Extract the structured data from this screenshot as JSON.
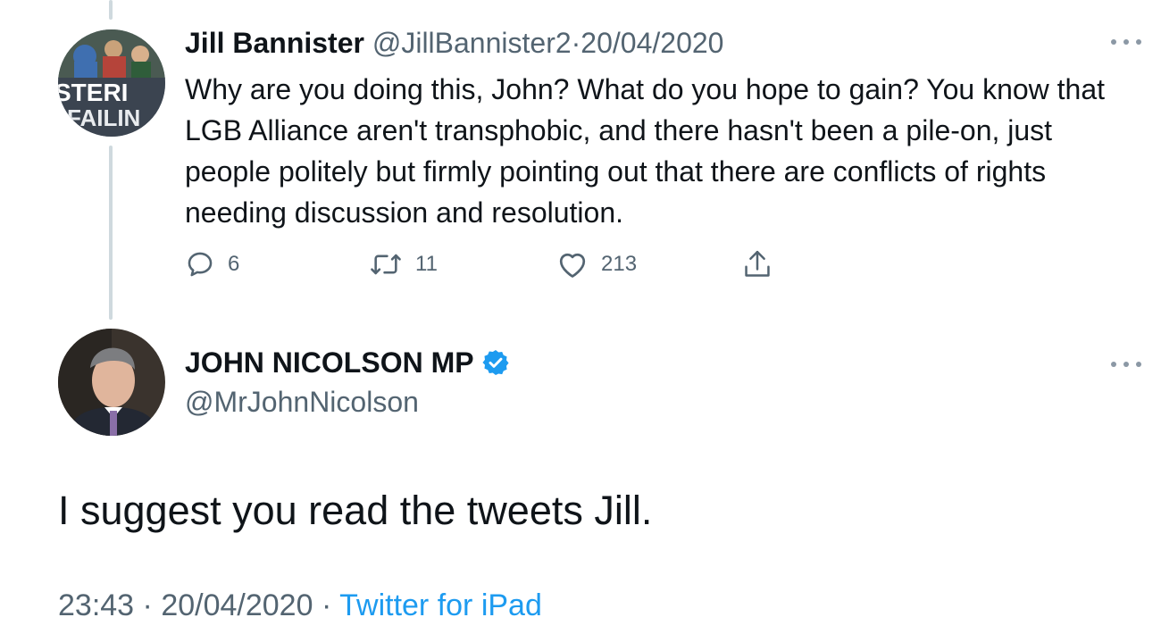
{
  "reply": {
    "author_name": "Jill Bannister",
    "handle": "@JillBannister2",
    "separator": "·",
    "date": "20/04/2020",
    "avatar_banner_line1": "STERI",
    "avatar_banner_line2": "FAILIN",
    "text": "Why are you doing this, John? What do you hope to gain? You know that LGB Alliance aren't transphobic, and there hasn't been a pile-on, just people politely but firmly pointing out that there are conflicts of rights needing discussion and resolution.",
    "replies_count": "6",
    "retweets_count": "11",
    "likes_count": "213",
    "icons": [
      "reply-icon",
      "retweet-icon",
      "like-icon",
      "share-icon",
      "more-icon"
    ]
  },
  "main": {
    "author_name": "JOHN NICOLSON MP",
    "verified": true,
    "handle": "@MrJohnNicolson",
    "text": "I suggest you read the tweets Jill.",
    "time": "23:43",
    "separator": "·",
    "date": "20/04/2020",
    "source": "Twitter for iPad"
  },
  "colors": {
    "text": "#0f1419",
    "muted": "#536471",
    "accent": "#1d9bf0",
    "thread_line": "#cfd9de"
  }
}
